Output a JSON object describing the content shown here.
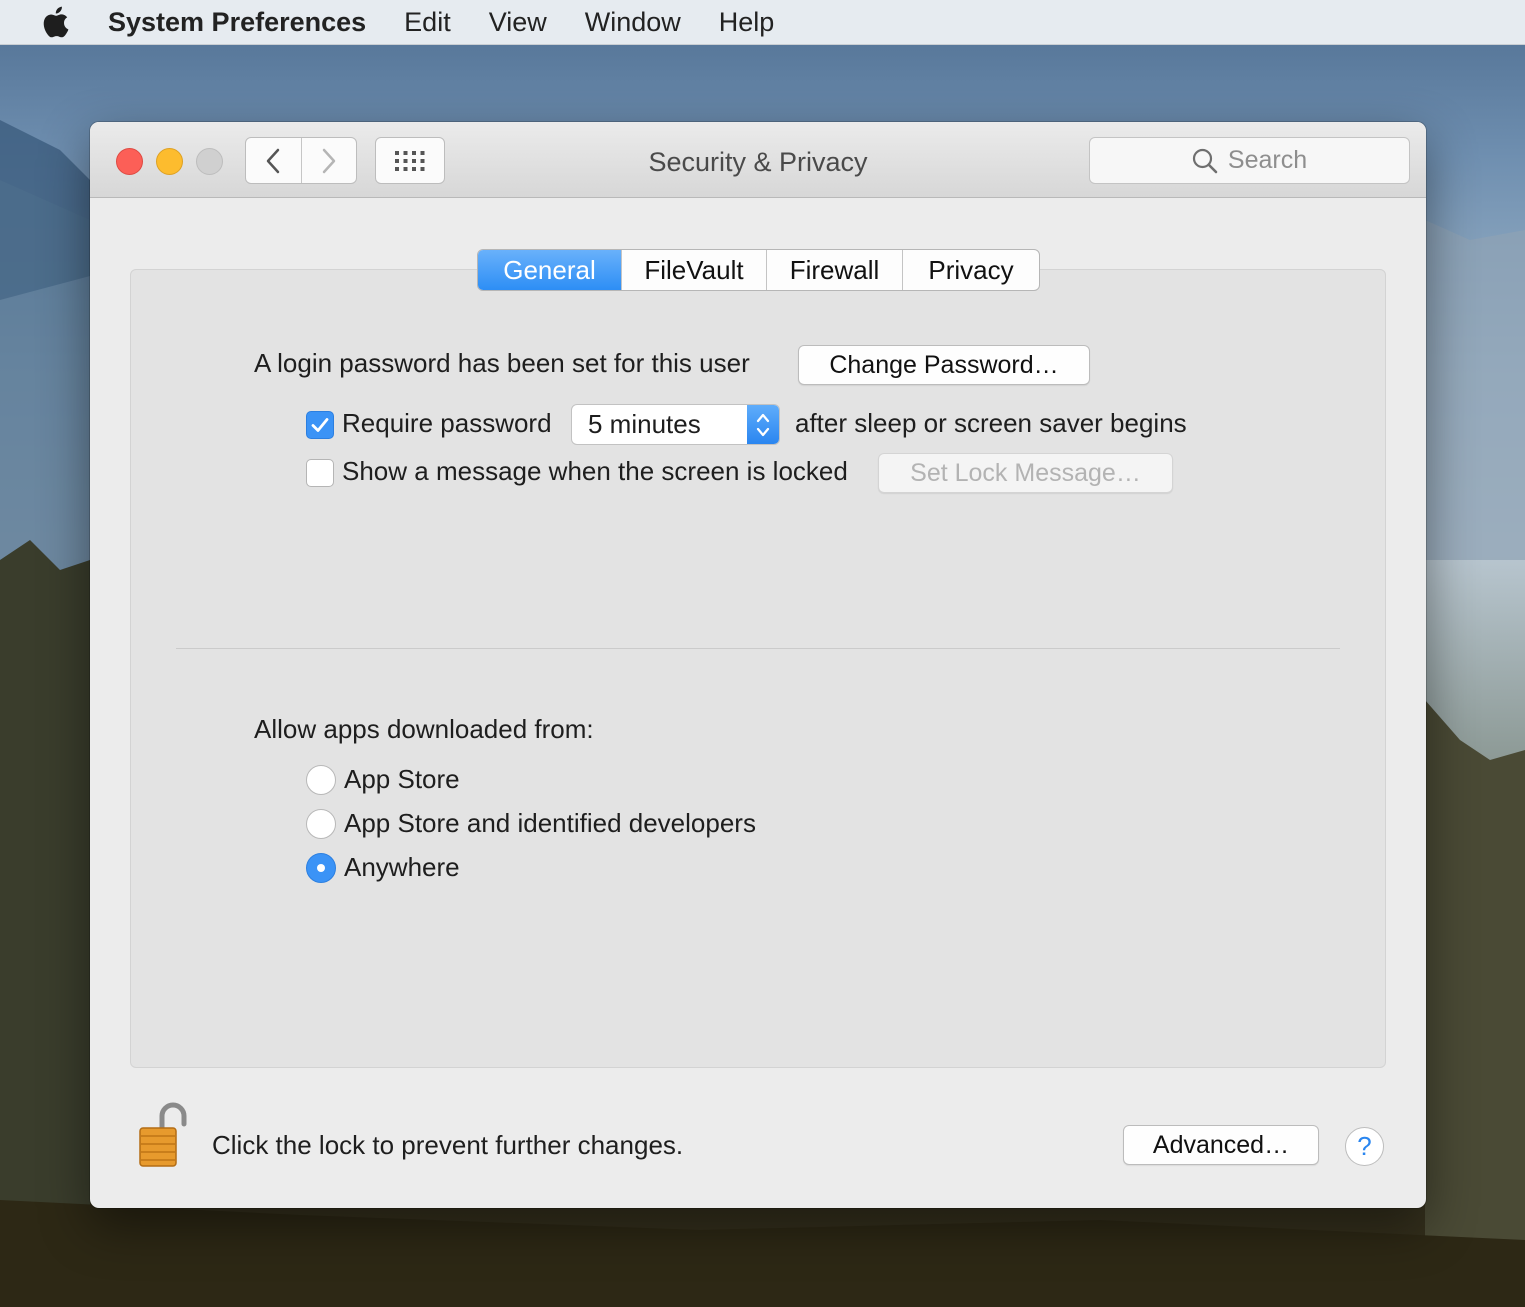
{
  "menubar": {
    "apple_icon": "apple-logo-icon",
    "app_name": "System Preferences",
    "menus": [
      "Edit",
      "View",
      "Window",
      "Help"
    ]
  },
  "window": {
    "title": "Security & Privacy",
    "search_placeholder": "Search",
    "toolbar_icons": [
      "back-chevron-icon",
      "forward-chevron-icon",
      "show-all-grid-icon",
      "search-icon"
    ]
  },
  "tabs": [
    {
      "label": "General",
      "active": true
    },
    {
      "label": "FileVault",
      "active": false
    },
    {
      "label": "Firewall",
      "active": false
    },
    {
      "label": "Privacy",
      "active": false
    }
  ],
  "general": {
    "login_password_text": "A login password has been set for this user",
    "change_password_button": "Change Password…",
    "require_password_label": "Require password",
    "require_password_checked": true,
    "require_password_delay": "5 minutes",
    "after_sleep_text": "after sleep or screen saver begins",
    "show_message_label": "Show a message when the screen is locked",
    "show_message_checked": false,
    "set_lock_message_button": "Set Lock Message…",
    "allow_apps_label": "Allow apps downloaded from:",
    "app_sources": [
      {
        "label": "App Store",
        "selected": false
      },
      {
        "label": "App Store and identified developers",
        "selected": false
      },
      {
        "label": "Anywhere",
        "selected": true
      }
    ]
  },
  "footer": {
    "lock_icon": "unlocked-padlock-icon",
    "lock_text": "Click the lock to prevent further changes.",
    "advanced_button": "Advanced…",
    "help_label": "?"
  },
  "colors": {
    "accent": "#3b93f6",
    "close": "#fc5f57",
    "minimize": "#fdbc2e",
    "zoom_disabled": "#d0d0d0",
    "window_bg": "#ececec",
    "panel_bg": "#e3e3e3"
  }
}
